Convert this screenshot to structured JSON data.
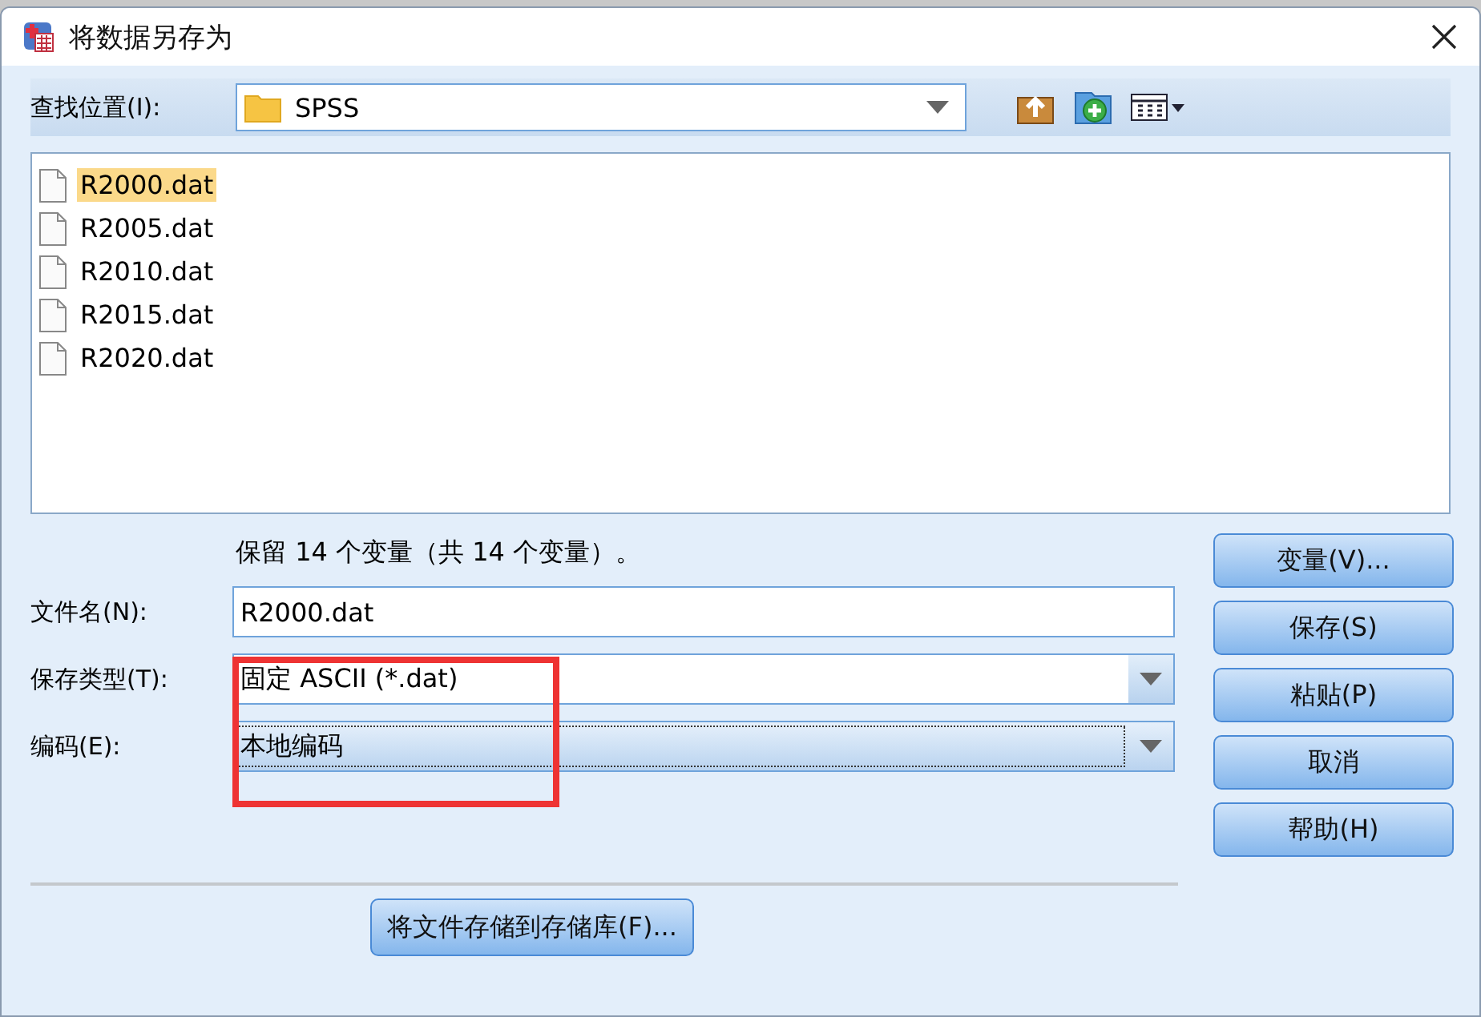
{
  "window": {
    "title": "将数据另存为"
  },
  "look_in": {
    "label": "查找位置(I):",
    "value": "SPSS"
  },
  "files": [
    {
      "name": "R2000.dat",
      "selected": true
    },
    {
      "name": "R2005.dat",
      "selected": false
    },
    {
      "name": "R2010.dat",
      "selected": false
    },
    {
      "name": "R2015.dat",
      "selected": false
    },
    {
      "name": "R2020.dat",
      "selected": false
    }
  ],
  "keep_note": "保留 14 个变量（共 14 个变量）。",
  "fields": [
    {
      "kind": "text",
      "label": "文件名(N):",
      "value": "R2000.dat"
    },
    {
      "kind": "dropdown",
      "label": "保存类型(T):",
      "value": "固定 ASCII (*.dat)",
      "focused": false
    },
    {
      "kind": "dropdown",
      "label": "编码(E):",
      "value": "本地编码",
      "focused": true
    }
  ],
  "buttons": [
    "变量(V)...",
    "保存(S)",
    "粘贴(P)",
    "取消",
    "帮助(H)"
  ],
  "repository_button": "将文件存储到存储库(F)...",
  "annotations": [
    {
      "kind": "rectangle",
      "color": "#ee3333"
    }
  ]
}
